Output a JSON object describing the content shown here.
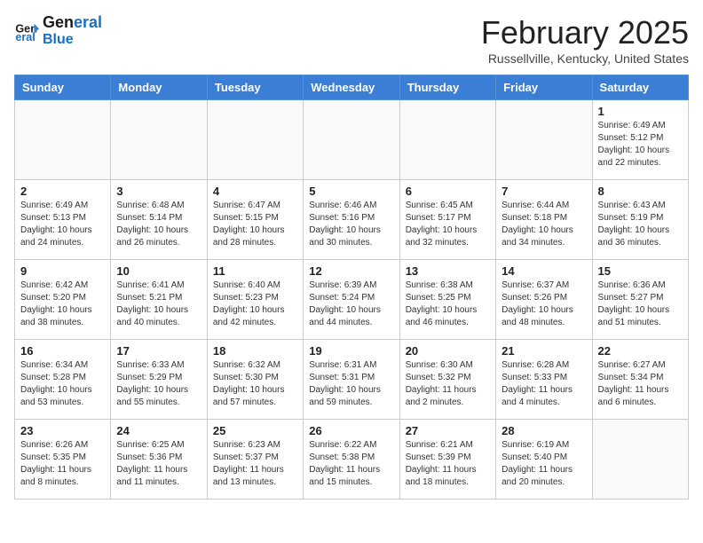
{
  "header": {
    "logo_line1": "General",
    "logo_line2": "Blue",
    "month": "February 2025",
    "location": "Russellville, Kentucky, United States"
  },
  "days_of_week": [
    "Sunday",
    "Monday",
    "Tuesday",
    "Wednesday",
    "Thursday",
    "Friday",
    "Saturday"
  ],
  "weeks": [
    [
      {
        "day": "",
        "info": ""
      },
      {
        "day": "",
        "info": ""
      },
      {
        "day": "",
        "info": ""
      },
      {
        "day": "",
        "info": ""
      },
      {
        "day": "",
        "info": ""
      },
      {
        "day": "",
        "info": ""
      },
      {
        "day": "1",
        "info": "Sunrise: 6:49 AM\nSunset: 5:12 PM\nDaylight: 10 hours\nand 22 minutes."
      }
    ],
    [
      {
        "day": "2",
        "info": "Sunrise: 6:49 AM\nSunset: 5:13 PM\nDaylight: 10 hours\nand 24 minutes."
      },
      {
        "day": "3",
        "info": "Sunrise: 6:48 AM\nSunset: 5:14 PM\nDaylight: 10 hours\nand 26 minutes."
      },
      {
        "day": "4",
        "info": "Sunrise: 6:47 AM\nSunset: 5:15 PM\nDaylight: 10 hours\nand 28 minutes."
      },
      {
        "day": "5",
        "info": "Sunrise: 6:46 AM\nSunset: 5:16 PM\nDaylight: 10 hours\nand 30 minutes."
      },
      {
        "day": "6",
        "info": "Sunrise: 6:45 AM\nSunset: 5:17 PM\nDaylight: 10 hours\nand 32 minutes."
      },
      {
        "day": "7",
        "info": "Sunrise: 6:44 AM\nSunset: 5:18 PM\nDaylight: 10 hours\nand 34 minutes."
      },
      {
        "day": "8",
        "info": "Sunrise: 6:43 AM\nSunset: 5:19 PM\nDaylight: 10 hours\nand 36 minutes."
      }
    ],
    [
      {
        "day": "9",
        "info": "Sunrise: 6:42 AM\nSunset: 5:20 PM\nDaylight: 10 hours\nand 38 minutes."
      },
      {
        "day": "10",
        "info": "Sunrise: 6:41 AM\nSunset: 5:21 PM\nDaylight: 10 hours\nand 40 minutes."
      },
      {
        "day": "11",
        "info": "Sunrise: 6:40 AM\nSunset: 5:23 PM\nDaylight: 10 hours\nand 42 minutes."
      },
      {
        "day": "12",
        "info": "Sunrise: 6:39 AM\nSunset: 5:24 PM\nDaylight: 10 hours\nand 44 minutes."
      },
      {
        "day": "13",
        "info": "Sunrise: 6:38 AM\nSunset: 5:25 PM\nDaylight: 10 hours\nand 46 minutes."
      },
      {
        "day": "14",
        "info": "Sunrise: 6:37 AM\nSunset: 5:26 PM\nDaylight: 10 hours\nand 48 minutes."
      },
      {
        "day": "15",
        "info": "Sunrise: 6:36 AM\nSunset: 5:27 PM\nDaylight: 10 hours\nand 51 minutes."
      }
    ],
    [
      {
        "day": "16",
        "info": "Sunrise: 6:34 AM\nSunset: 5:28 PM\nDaylight: 10 hours\nand 53 minutes."
      },
      {
        "day": "17",
        "info": "Sunrise: 6:33 AM\nSunset: 5:29 PM\nDaylight: 10 hours\nand 55 minutes."
      },
      {
        "day": "18",
        "info": "Sunrise: 6:32 AM\nSunset: 5:30 PM\nDaylight: 10 hours\nand 57 minutes."
      },
      {
        "day": "19",
        "info": "Sunrise: 6:31 AM\nSunset: 5:31 PM\nDaylight: 10 hours\nand 59 minutes."
      },
      {
        "day": "20",
        "info": "Sunrise: 6:30 AM\nSunset: 5:32 PM\nDaylight: 11 hours\nand 2 minutes."
      },
      {
        "day": "21",
        "info": "Sunrise: 6:28 AM\nSunset: 5:33 PM\nDaylight: 11 hours\nand 4 minutes."
      },
      {
        "day": "22",
        "info": "Sunrise: 6:27 AM\nSunset: 5:34 PM\nDaylight: 11 hours\nand 6 minutes."
      }
    ],
    [
      {
        "day": "23",
        "info": "Sunrise: 6:26 AM\nSunset: 5:35 PM\nDaylight: 11 hours\nand 8 minutes."
      },
      {
        "day": "24",
        "info": "Sunrise: 6:25 AM\nSunset: 5:36 PM\nDaylight: 11 hours\nand 11 minutes."
      },
      {
        "day": "25",
        "info": "Sunrise: 6:23 AM\nSunset: 5:37 PM\nDaylight: 11 hours\nand 13 minutes."
      },
      {
        "day": "26",
        "info": "Sunrise: 6:22 AM\nSunset: 5:38 PM\nDaylight: 11 hours\nand 15 minutes."
      },
      {
        "day": "27",
        "info": "Sunrise: 6:21 AM\nSunset: 5:39 PM\nDaylight: 11 hours\nand 18 minutes."
      },
      {
        "day": "28",
        "info": "Sunrise: 6:19 AM\nSunset: 5:40 PM\nDaylight: 11 hours\nand 20 minutes."
      },
      {
        "day": "",
        "info": ""
      }
    ]
  ]
}
